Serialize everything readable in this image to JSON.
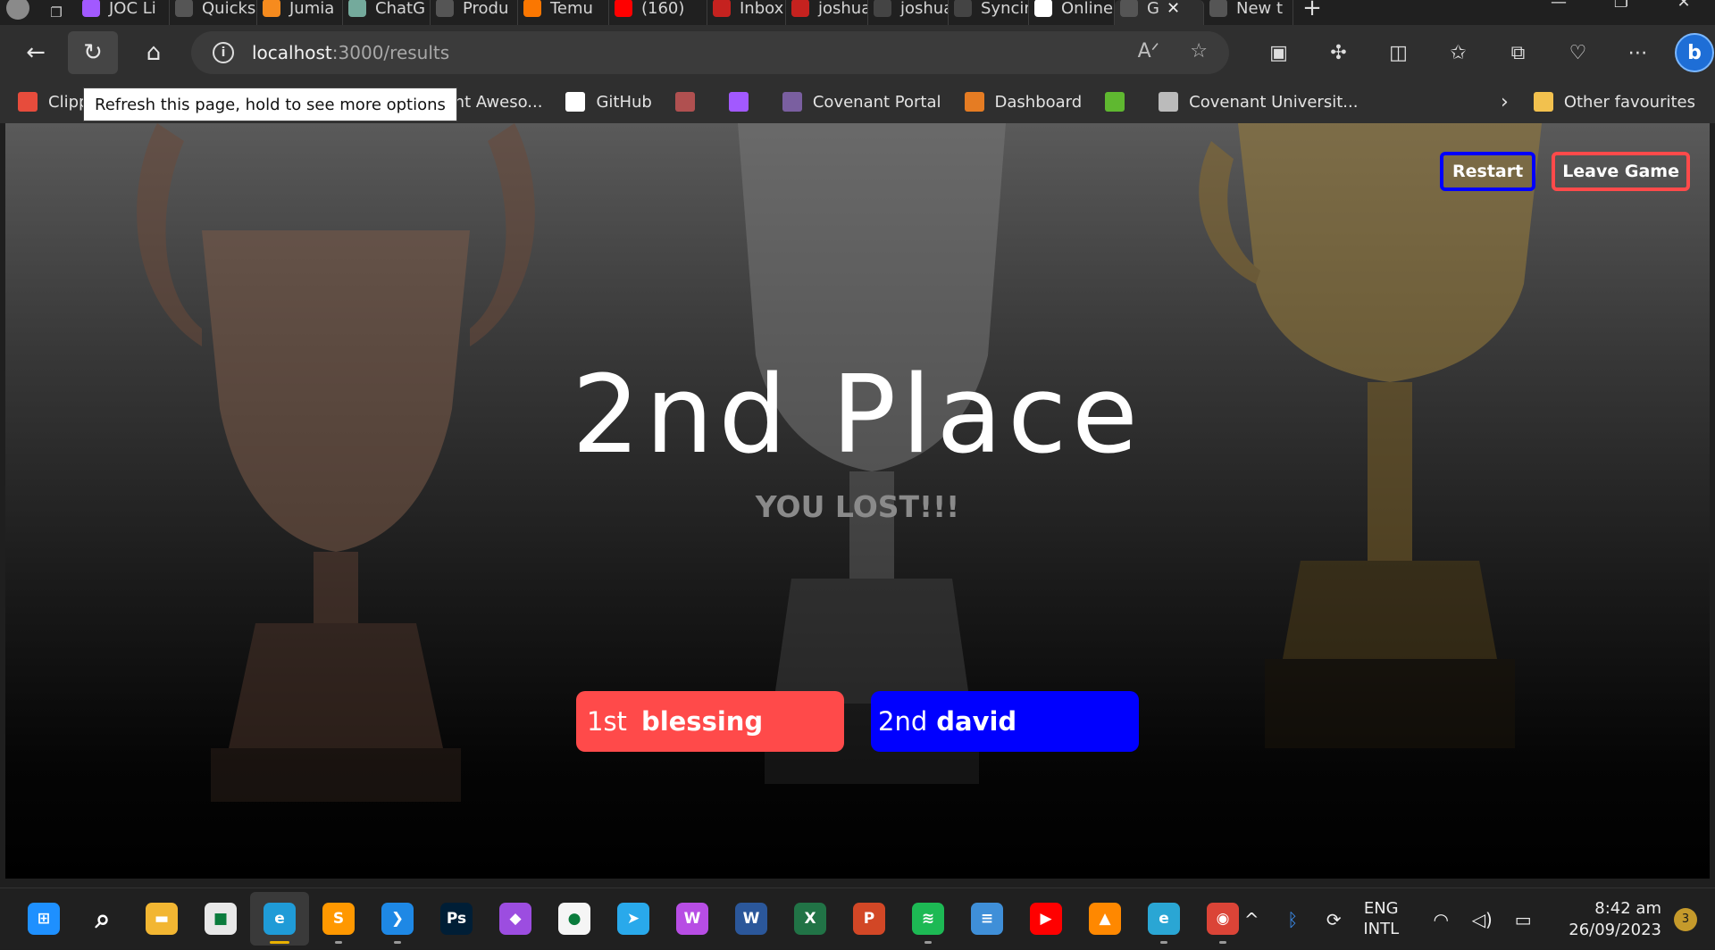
{
  "browser": {
    "tabs": [
      {
        "label": "JOC Li",
        "icon": "figma-icon",
        "color": "#a259ff"
      },
      {
        "label": "Quicks",
        "icon": "page-icon",
        "color": "#555555"
      },
      {
        "label": "Jumia",
        "icon": "jumia-icon",
        "color": "#f68b1e"
      },
      {
        "label": "ChatG",
        "icon": "chatgpt-icon",
        "color": "#74aa9c"
      },
      {
        "label": "Produ",
        "icon": "page-icon",
        "color": "#555555"
      },
      {
        "label": "Temu",
        "icon": "temu-icon",
        "color": "#fb7701"
      },
      {
        "label": "(160)",
        "icon": "youtube-icon",
        "color": "#ff0000"
      },
      {
        "label": "Inbox",
        "icon": "gmail-icon",
        "color": "#c5221f"
      },
      {
        "label": "joshua",
        "icon": "gmail-icon",
        "color": "#c5221f"
      },
      {
        "label": "joshua",
        "icon": "github-icon",
        "color": "#444444"
      },
      {
        "label": "Syncin",
        "icon": "github-icon",
        "color": "#444444"
      },
      {
        "label": "Online",
        "icon": "github-icon",
        "color": "#ffffff"
      },
      {
        "label": "G",
        "icon": "page-icon",
        "color": "#555555",
        "active": true
      },
      {
        "label": "New t",
        "icon": "newtab-icon",
        "color": "#555555"
      }
    ],
    "url_host": "localhost",
    "url_path": ":3000/results",
    "tooltip": "Refresh this page, hold to see more options",
    "favorites": [
      {
        "label": "Clipp",
        "icon": "clipchamp-icon",
        "color": "#e74c3c"
      },
      {
        "label": "",
        "icon": "gmail-icon",
        "color": "#c5221f"
      },
      {
        "label": "Icons | Font Aweso...",
        "icon": "flag-icon",
        "color": "#538dd7"
      },
      {
        "label": "GitHub",
        "icon": "github-icon",
        "color": "#ffffff"
      },
      {
        "label": "",
        "icon": "image-icon",
        "color": "#b05050"
      },
      {
        "label": "",
        "icon": "figma-icon",
        "color": "#a259ff"
      },
      {
        "label": "Covenant Portal",
        "icon": "crest-icon",
        "color": "#7a5fa0"
      },
      {
        "label": "Dashboard",
        "icon": "in-icon",
        "color": "#e57c23"
      },
      {
        "label": "",
        "icon": "download-icon",
        "color": "#5fb830"
      },
      {
        "label": "Covenant Universit...",
        "icon": "page-icon",
        "color": "#bbbbbb"
      }
    ],
    "other_favourites": "Other favourites"
  },
  "game": {
    "restart_label": "Restart",
    "leave_label": "Leave Game",
    "place_title": "2nd Place",
    "result_text": "YOU LOST!!!",
    "scores": [
      {
        "rank": "1st",
        "name": "blessing",
        "color": "#ff4a4a"
      },
      {
        "rank": "2nd",
        "name": "david",
        "color": "#0000ff"
      }
    ]
  },
  "taskbar": {
    "apps": [
      {
        "name": "start-icon",
        "color": "#1e90ff",
        "glyph": "⊞"
      },
      {
        "name": "search-icon",
        "color": "transparent",
        "glyph": "⌕"
      },
      {
        "name": "file-explorer-icon",
        "color": "#f2b632",
        "glyph": "▬"
      },
      {
        "name": "store-icon",
        "color": "#e8e8e8",
        "glyph": "■"
      },
      {
        "name": "edge-icon",
        "color": "#1f9bd7",
        "glyph": "e"
      },
      {
        "name": "sublime-icon",
        "color": "#ff9800",
        "glyph": "S"
      },
      {
        "name": "vscode-icon",
        "color": "#1e88e5",
        "glyph": "❯"
      },
      {
        "name": "photoshop-icon",
        "color": "#001e36",
        "glyph": "Ps"
      },
      {
        "name": "git-icon",
        "color": "#9c4de0",
        "glyph": "◆"
      },
      {
        "name": "mongodb-icon",
        "color": "#f5f5f5",
        "glyph": "●"
      },
      {
        "name": "telegram-icon",
        "color": "#29a9eb",
        "glyph": "➤"
      },
      {
        "name": "wps-icon",
        "color": "#b74de4",
        "glyph": "W"
      },
      {
        "name": "word-icon",
        "color": "#2b579a",
        "glyph": "W"
      },
      {
        "name": "excel-icon",
        "color": "#217346",
        "glyph": "X"
      },
      {
        "name": "powerpoint-icon",
        "color": "#d24726",
        "glyph": "P"
      },
      {
        "name": "spotify-icon",
        "color": "#1db954",
        "glyph": "≋"
      },
      {
        "name": "notepad-icon",
        "color": "#3f8fd8",
        "glyph": "≡"
      },
      {
        "name": "youtube-music-icon",
        "color": "#ff0000",
        "glyph": "▶"
      },
      {
        "name": "vlc-icon",
        "color": "#ff8800",
        "glyph": "▲"
      },
      {
        "name": "edge-dev-icon",
        "color": "#2aa6d4",
        "glyph": "e"
      },
      {
        "name": "chrome-icon",
        "color": "#db4437",
        "glyph": "◉"
      }
    ],
    "lang_line1": "ENG",
    "lang_line2": "INTL",
    "time": "8:42 am",
    "date": "26/09/2023",
    "notifications": "3"
  }
}
